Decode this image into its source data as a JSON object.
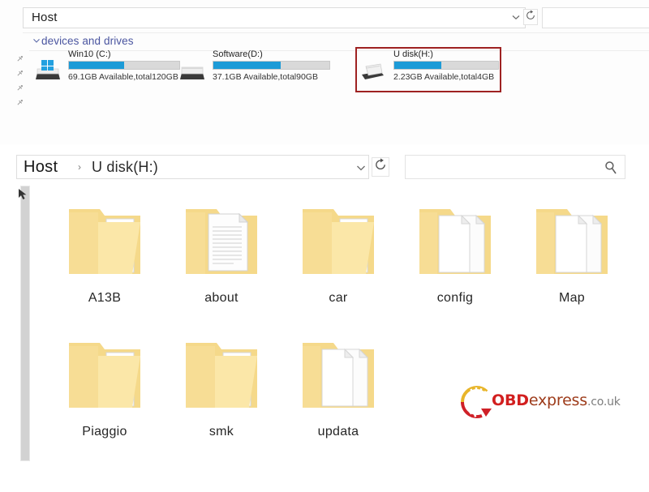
{
  "top_explorer": {
    "address_value": "Host",
    "search_value": "",
    "search_placeholder": "",
    "chevron_icon": "chevron-down-icon",
    "refresh_icon": "refresh-icon",
    "group_header": {
      "label": "devices and drives",
      "chevron_icon": "chevron-down-icon"
    },
    "drives": [
      {
        "name": "Win10 (C:)",
        "info": "69.1GB Available,total120GB",
        "fill_percent": 50,
        "icon": "hard-drive-windows-icon",
        "highlighted": false
      },
      {
        "name": "Software(D:)",
        "info": "37.1GB Available,total90GB",
        "fill_percent": 58,
        "icon": "hard-drive-icon",
        "highlighted": false
      },
      {
        "name": "U disk(H:)",
        "info": "2.23GB Available,total4GB",
        "fill_percent": 45,
        "icon": "usb-drive-icon",
        "highlighted": true
      }
    ],
    "pin_icon": "pin-icon",
    "pin_count": 4,
    "highlight_color": "#9e2222",
    "bar_fill_color": "#1d9bd7"
  },
  "main_explorer": {
    "breadcrumb": {
      "root": "Host",
      "separator": "›",
      "leaf": "U disk(H:)"
    },
    "chevron_icon": "chevron-down-icon",
    "refresh_icon": "refresh-icon",
    "search": {
      "value": "",
      "placeholder": "",
      "icon": "search-icon"
    },
    "rail_cursor_icon": "cursor-arrow-icon",
    "folders": [
      {
        "label": "A13B",
        "icon": "folder-open-icon"
      },
      {
        "label": "about",
        "icon": "folder-open-icon"
      },
      {
        "label": "car",
        "icon": "folder-open-icon"
      },
      {
        "label": "config",
        "icon": "folder-open-icon"
      },
      {
        "label": "Map",
        "icon": "folder-open-icon"
      },
      {
        "label": "Piaggio",
        "icon": "folder-open-icon"
      },
      {
        "label": "smk",
        "icon": "folder-open-icon"
      },
      {
        "label": "updata",
        "icon": "folder-open-icon"
      }
    ]
  },
  "watermark": {
    "part1": "OBD",
    "part2": "express",
    "part3": ".co.uk",
    "logo_icon": "circular-arrow-logo-icon",
    "color_part1": "#d21f1f",
    "color_part2": "#9d3b1a",
    "color_part3": "#7d7d7d"
  }
}
